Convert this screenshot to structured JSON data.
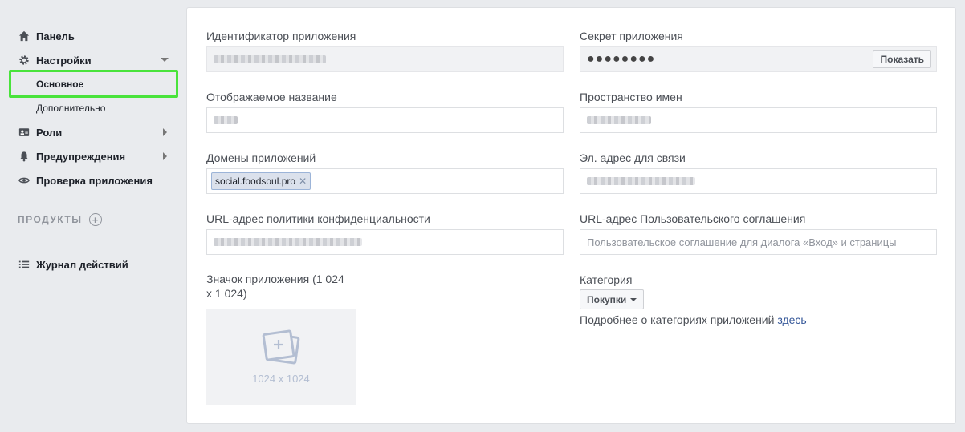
{
  "sidebar": {
    "dashboard": {
      "label": "Панель",
      "icon": "home-icon"
    },
    "settings": {
      "label": "Настройки",
      "icon": "gear-icon"
    },
    "settings_basic": "Основное",
    "settings_advanced": "Дополнительно",
    "roles": {
      "label": "Роли",
      "icon": "id-card-icon"
    },
    "alerts": {
      "label": "Предупреждения",
      "icon": "bell-icon"
    },
    "app_review": {
      "label": "Проверка приложения",
      "icon": "eye-icon"
    },
    "products_label": "ПРОДУКТЫ",
    "activity_log": {
      "label": "Журнал действий",
      "icon": "list-icon"
    }
  },
  "form": {
    "app_id": {
      "label": "Идентификатор приложения"
    },
    "app_secret": {
      "label": "Секрет приложения",
      "value": "●●●●●●●●",
      "show_label": "Показать"
    },
    "display_name": {
      "label": "Отображаемое название"
    },
    "namespace": {
      "label": "Пространство имен"
    },
    "app_domains": {
      "label": "Домены приложений",
      "tags": [
        "social.foodsoul.pro"
      ]
    },
    "contact_email": {
      "label": "Эл. адрес для связи"
    },
    "privacy_url": {
      "label": "URL-адрес политики конфиденциальности"
    },
    "tos_url": {
      "label": "URL-адрес Пользовательского соглашения",
      "placeholder": "Пользовательское соглашение для диалога «Вход» и страницы"
    },
    "app_icon": {
      "label_line1": "Значок приложения (1 024",
      "label_line2": "x 1 024)",
      "dimensions": "1024 x 1024"
    },
    "category": {
      "label": "Категория",
      "value": "Покупки",
      "more_text": "Подробнее о категориях приложений",
      "more_link": "здесь"
    }
  },
  "colors": {
    "highlight": "#49e33b",
    "link": "#365899",
    "tag_bg": "#dbe1ec"
  }
}
